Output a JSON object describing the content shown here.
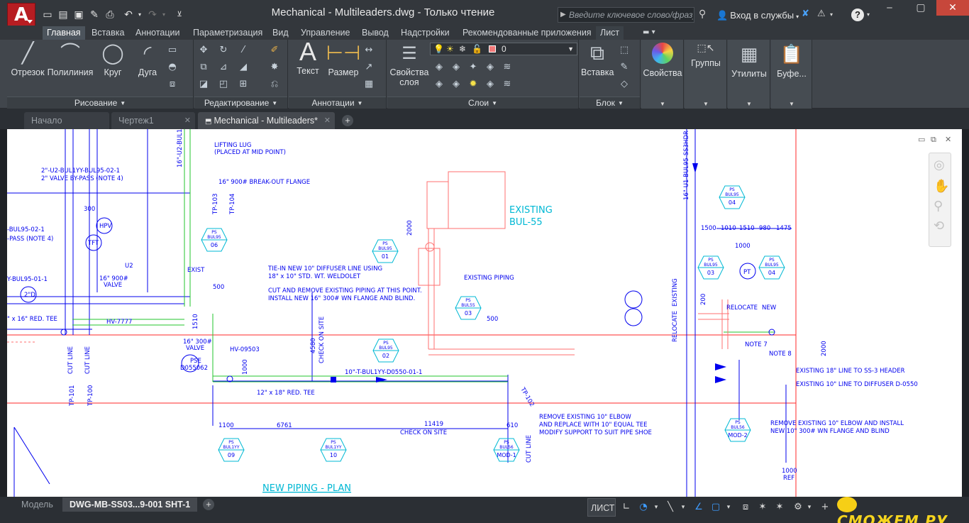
{
  "titlebar": {
    "title": "Mechanical - Multileaders.dwg - Только чтение",
    "search_placeholder": "Введите ключевое слово/фразу",
    "signin_label": "Вход в службы",
    "help_label": "?",
    "logo_letter": "A"
  },
  "menubar": {
    "tabs": [
      "Главная",
      "Вставка",
      "Аннотации",
      "Параметризация",
      "Вид",
      "Управление",
      "Вывод",
      "Надстройки",
      "Рекомендованные приложения",
      "Лист"
    ],
    "active_index": 0
  },
  "ribbon": {
    "draw": {
      "line": "Отрезок",
      "polyline": "Полилиния",
      "circle": "Круг",
      "arc": "Дуга",
      "panel_label": "Рисование"
    },
    "modify": {
      "panel_label": "Редактирование"
    },
    "annotations": {
      "text": "Текст",
      "dimension": "Размер",
      "panel_label": "Аннотации"
    },
    "layers": {
      "properties_line1": "Свойства",
      "properties_line2": "слоя",
      "current_layer": "0",
      "panel_label": "Слои"
    },
    "block": {
      "insert": "Вставка",
      "panel_label": "Блок"
    },
    "properties": {
      "label": "Свойства"
    },
    "groups": {
      "label": "Группы"
    },
    "utilities": {
      "label": "Утилиты"
    },
    "clipboard": {
      "label": "Буфе..."
    }
  },
  "doctabs": {
    "start": "Начало",
    "drawing1": "Чертеж1",
    "active": "Mechanical - Multileaders*"
  },
  "bottom": {
    "model": "Модель",
    "layout": "DWG-MB-SS03...9-001 SHT-1",
    "space_label": "ЛИСТ"
  },
  "watermark": "СМОЖЕМ.РУ",
  "drawing": {
    "texts": [
      "LIFTING LUG",
      "(PLACED AT MID POINT)",
      "16\" 900# BREAK-OUT FLANGE",
      "2\"-U2-BUL1YY-BUL95-02-1",
      "2\" VALVE BY-PASS (NOTE 4)",
      "TIE-IN NEW 10\" DIFFUSER LINE USING",
      "18\" x 10\" STD. WT. WELDOLET",
      "CUT AND REMOVE EXISTING PIPING AT THIS POINT.",
      "INSTALL NEW 16\" 300# WN FLANGE AND BLIND.",
      "EXISTING",
      "BUL-55",
      "EXISTING PIPING",
      "10\"-T-BUL1YY-D0550-01-1",
      "12\" x 18\" RED. TEE",
      "REMOVE EXISTING 10\" ELBOW",
      "AND REPLACE WITH 10\" EQUAL TEE",
      "MODIFY SUPPORT TO SUIT PIPE SHOE",
      "EXISTING 18\" LINE TO SS-3 HEADER",
      "EXISTING 10\" LINE TO DIFFUSER D-0550",
      "REMOVE EXISTING 10\" ELBOW AND INSTALL",
      "NEW 10\" 300# WN FLANGE AND BLIND",
      "NOTE 7",
      "NOTE 8",
      "RELOCATE",
      "NEW",
      "EXISTING",
      "RELOCATE",
      "NEW PIPING - PLAN",
      "CHECK ON SITE",
      "CHECK ON SITE",
      "HV-7777",
      "HV-09503",
      "EXIST",
      "VALVE",
      "16\" 900#",
      "1100",
      "6761",
      "11419",
      "610",
      "1510",
      "500",
      "2000",
      "4580",
      "1000",
      "1500",
      "1010",
      "1510",
      "980",
      "1475",
      "1000",
      "200",
      "500",
      "-BUL95-02-1",
      "-PASS (NOTE 4)",
      "Y-BUL95-01-1",
      "\" x 16\" RED. TEE",
      "300",
      "U2",
      "PSE",
      "D055062",
      "HPV",
      "TFT",
      "2\"D",
      "PT",
      "CUT LINE",
      "CUT LINE",
      "CUT LINE",
      "TP-101",
      "TP-100",
      "TP-103",
      "TP-104",
      "TP-102",
      "1000",
      "REF",
      "16\"-U2-BUL1",
      "16\"-U1-BUL95-SS3HDR-1"
    ],
    "tags": [
      {
        "l1": "PS",
        "l2": "BUL95",
        "n": "06"
      },
      {
        "l1": "PS",
        "l2": "BUL95",
        "n": "01"
      },
      {
        "l1": "PS",
        "l2": "BUL95",
        "n": "02"
      },
      {
        "l1": "PS",
        "l2": "BUL55",
        "n": "03"
      },
      {
        "l1": "PS",
        "l2": "BUL95",
        "n": "04"
      },
      {
        "l1": "PS",
        "l2": "BUL95",
        "n": "03"
      },
      {
        "l1": "PS",
        "l2": "BUL95",
        "n": "04"
      },
      {
        "l1": "PS",
        "l2": "BUL95",
        "n": "02"
      },
      {
        "l1": "PS",
        "l2": "BUL1YY",
        "n": "09"
      },
      {
        "l1": "PS",
        "l2": "BUL1YY",
        "n": "10"
      },
      {
        "l1": "PS",
        "l2": "BUL56",
        "n": "MOD-1"
      },
      {
        "l1": "PS",
        "l2": "BUL56",
        "n": "MOD-2"
      }
    ]
  }
}
